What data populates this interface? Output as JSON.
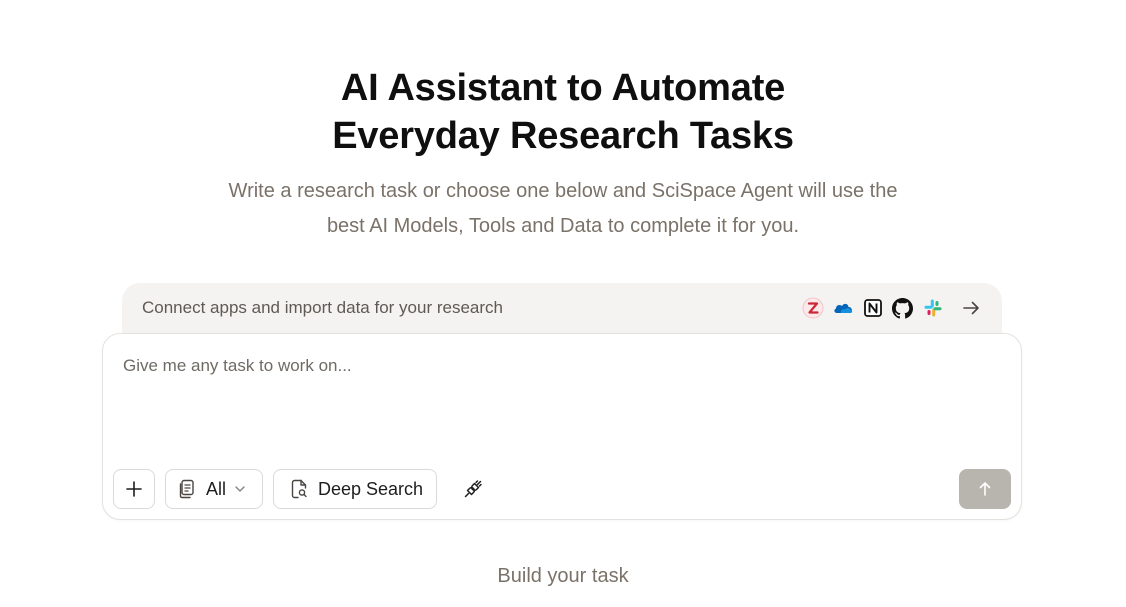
{
  "hero": {
    "title_line1": "AI Assistant to Automate",
    "title_line2": "Everyday Research Tasks",
    "subtitle_line1": "Write a research task or choose one below and SciSpace Agent will use the",
    "subtitle_line2": "best AI Models, Tools and Data to complete it for you."
  },
  "connect": {
    "text": "Connect apps and import data for your research",
    "apps": [
      "zotero-icon",
      "onedrive-icon",
      "notion-icon",
      "github-icon",
      "slack-icon"
    ],
    "colors": {
      "zotero": "#cc2936",
      "onedrive": "#0364b8",
      "slack_blue": "#36c5f0",
      "slack_green": "#2eb67d",
      "slack_yellow": "#ecb22e",
      "slack_red": "#e01e5a"
    }
  },
  "task": {
    "placeholder": "Give me any task to work on...",
    "filter_label": "All",
    "deep_search_label": "Deep Search",
    "send_color": "#b8b4ae"
  },
  "footer": {
    "build_label": "Build your task"
  }
}
